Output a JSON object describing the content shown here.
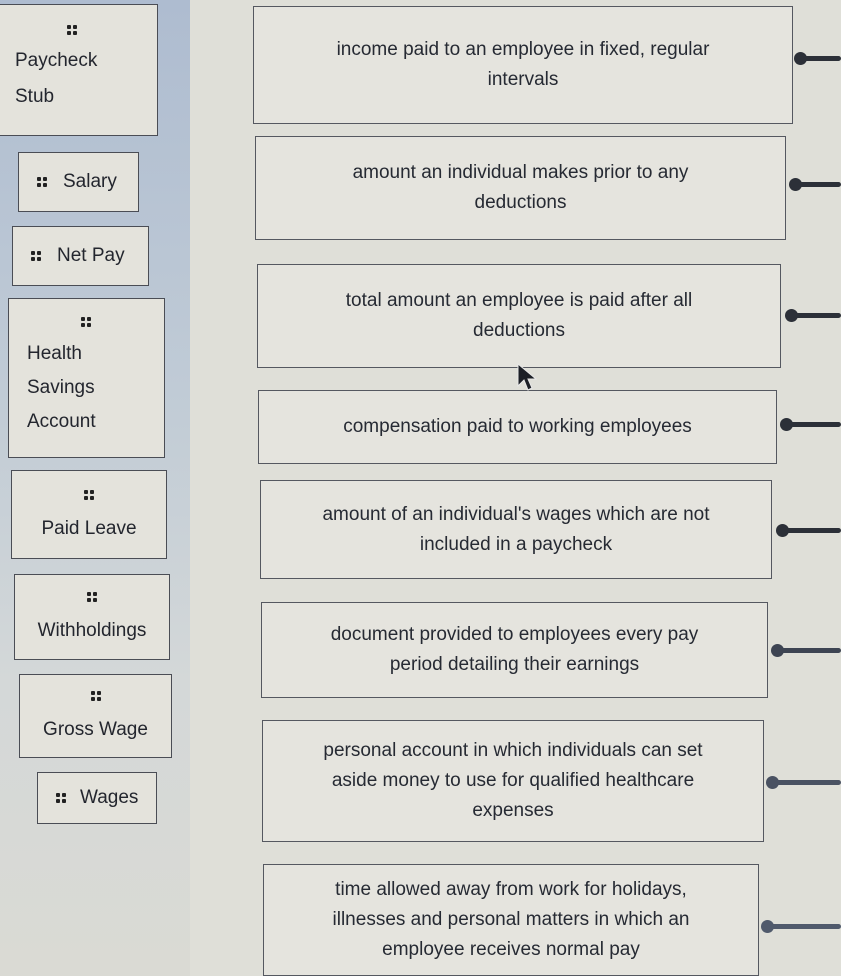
{
  "terms": [
    {
      "label": "Paycheck Stub",
      "lines": [
        "Paycheck",
        "Stub"
      ]
    },
    {
      "label": "Salary"
    },
    {
      "label": "Net Pay"
    },
    {
      "label": "Health Savings Account",
      "lines": [
        "Health",
        "Savings",
        "Account"
      ]
    },
    {
      "label": "Paid Leave"
    },
    {
      "label": "Withholdings"
    },
    {
      "label": "Gross Wage"
    },
    {
      "label": "Wages"
    }
  ],
  "definitions": [
    {
      "lines": [
        "income paid to an employee in fixed, regular",
        "intervals"
      ]
    },
    {
      "lines": [
        "amount an individual makes prior to any",
        "deductions"
      ]
    },
    {
      "lines": [
        "total amount an employee is paid after all",
        "deductions"
      ]
    },
    {
      "lines": [
        "compensation paid to working employees"
      ]
    },
    {
      "lines": [
        "amount of an individual's wages which are not",
        "included in a paycheck"
      ]
    },
    {
      "lines": [
        "document provided to employees every pay",
        "period detailing their earnings"
      ]
    },
    {
      "lines": [
        "personal account in which individuals can set",
        "aside money to use for qualified healthcare",
        "expenses"
      ]
    },
    {
      "lines": [
        "time allowed away from work for holidays,",
        "illnesses and personal matters in which an",
        "employee receives normal pay"
      ]
    }
  ],
  "icons": {
    "grip": "drag-handle-icon",
    "connector": "connector-dot-icon",
    "cursor": "mouse-pointer-icon"
  },
  "colors": {
    "left_strip": "#aebcd0",
    "card": "#e4e3dc",
    "border": "#4a4d55",
    "connector": "#2c3038"
  }
}
